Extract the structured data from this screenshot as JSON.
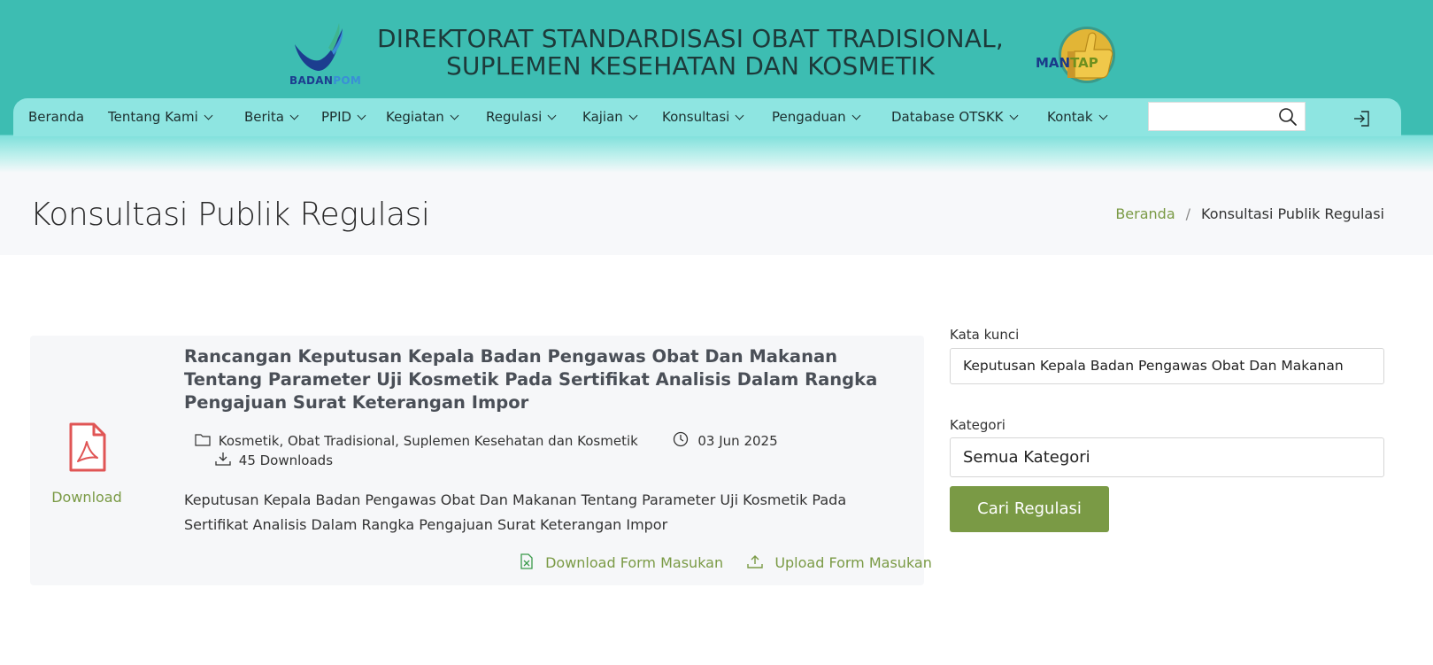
{
  "header": {
    "logo_left_caption_main": "BADAN",
    "logo_left_caption_accent": "POM",
    "title_line1": "DIREKTORAT STANDARDISASI OBAT TRADISIONAL,",
    "title_line2": "SUPLEMEN KESEHATAN DAN KOSMETIK",
    "logo_right_word_main": "MAN",
    "logo_right_word_accent": "TAP"
  },
  "nav": {
    "items": [
      {
        "label": "Beranda",
        "has_dropdown": false
      },
      {
        "label": "Tentang Kami",
        "has_dropdown": true
      },
      {
        "label": "Berita",
        "has_dropdown": true
      },
      {
        "label": "PPID",
        "has_dropdown": true
      },
      {
        "label": "Kegiatan",
        "has_dropdown": true
      },
      {
        "label": "Regulasi",
        "has_dropdown": true
      },
      {
        "label": "Kajian",
        "has_dropdown": true
      },
      {
        "label": "Konsultasi",
        "has_dropdown": true
      },
      {
        "label": "Pengaduan",
        "has_dropdown": true
      },
      {
        "label": "Database OTSKK",
        "has_dropdown": true
      },
      {
        "label": "Kontak",
        "has_dropdown": true
      }
    ],
    "search_value": "",
    "search_icon": "search-icon",
    "login_icon": "login-icon"
  },
  "page": {
    "title": "Konsultasi Publik Regulasi",
    "breadcrumb_home": "Beranda",
    "breadcrumb_sep": "/",
    "breadcrumb_current": "Konsultasi Publik Regulasi"
  },
  "card": {
    "file_icon": "pdf-file-icon",
    "download_label": "Download",
    "title": "Rancangan Keputusan Kepala Badan Pengawas Obat Dan Makanan Tentang Parameter Uji Kosmetik Pada Sertifikat Analisis Dalam Rangka Pengajuan Surat Keterangan Impor",
    "categories": "Kosmetik, Obat Tradisional, Suplemen Kesehatan dan Kosmetik",
    "date": "03 Jun 2025",
    "downloads": "45 Downloads",
    "description": "Keputusan Kepala Badan Pengawas Obat Dan Makanan Tentang Parameter Uji Kosmetik Pada Sertifikat Analisis Dalam Rangka Pengajuan Surat Keterangan Impor",
    "download_form_label": "Download Form Masukan",
    "upload_form_label": "Upload Form Masukan"
  },
  "sidebar": {
    "keyword_label": "Kata kunci",
    "keyword_value": "Keputusan Kepala Badan Pengawas Obat Dan Makanan",
    "category_label": "Kategori",
    "category_value": "Semua Kategori",
    "submit_label": "Cari Regulasi"
  },
  "colors": {
    "header_teal": "#3dbdb2",
    "nav_bg": "#8ee5e1",
    "accent_green": "#7a9a45",
    "pdf_red": "#e05555"
  }
}
